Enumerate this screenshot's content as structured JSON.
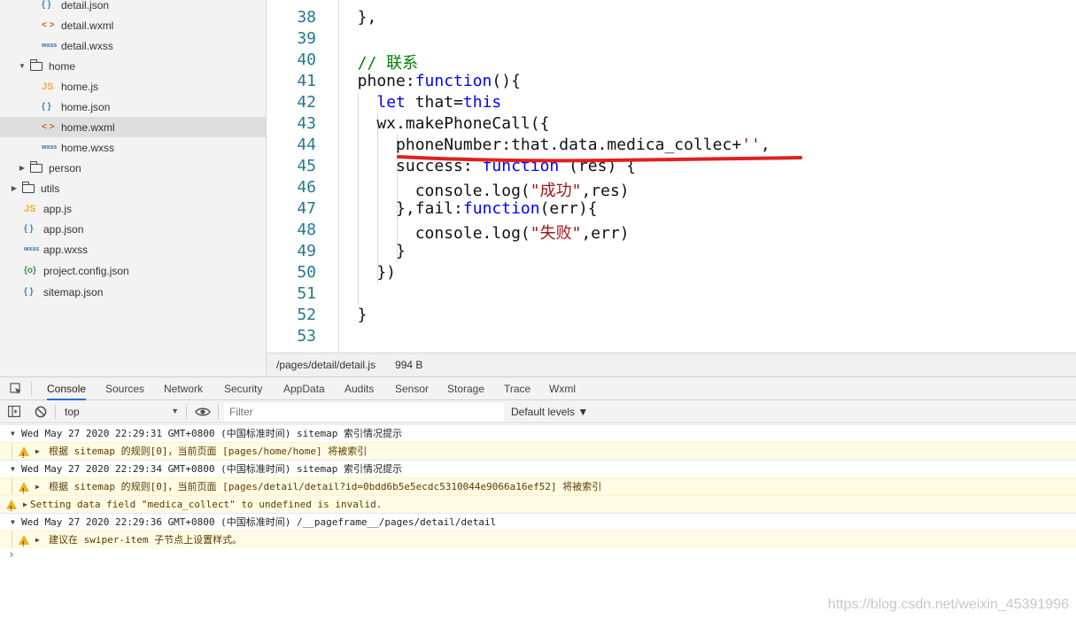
{
  "file_tree": [
    {
      "label": "detail.json",
      "icon": "{ }",
      "type": "json"
    },
    {
      "label": "detail.wxml",
      "icon": "< >",
      "type": "xml"
    },
    {
      "label": "detail.wxss",
      "icon": "wxss",
      "type": "wxss"
    },
    {
      "label": "home",
      "caret": "▼",
      "type": "folder-open"
    },
    {
      "label": "home.js",
      "icon": "JS",
      "type": "js"
    },
    {
      "label": "home.json",
      "icon": "{ }",
      "type": "json"
    },
    {
      "label": "home.wxml",
      "icon": "< >",
      "type": "xml",
      "selected": true
    },
    {
      "label": "home.wxss",
      "icon": "wxss",
      "type": "wxss"
    },
    {
      "label": "person",
      "caret": "▶",
      "type": "folder"
    },
    {
      "label": "utils",
      "caret": "▶",
      "type": "folder"
    },
    {
      "label": "app.js",
      "icon": "JS",
      "type": "js"
    },
    {
      "label": "app.json",
      "icon": "{ }",
      "type": "json"
    },
    {
      "label": "app.wxss",
      "icon": "wxss",
      "type": "wxss"
    },
    {
      "label": "project.config.json",
      "icon": "{o}",
      "type": "cfg"
    },
    {
      "label": "sitemap.json",
      "icon": "{ }",
      "type": "json"
    }
  ],
  "editor": {
    "lines": [
      {
        "n": "38",
        "code": [
          [
            "p",
            "  },"
          ]
        ]
      },
      {
        "n": "39",
        "code": []
      },
      {
        "n": "40",
        "code": [
          [
            "cm",
            "  // 联系"
          ]
        ]
      },
      {
        "n": "41",
        "code": [
          [
            "p",
            "  phone:"
          ],
          [
            "kw",
            "function"
          ],
          [
            "p",
            "(){"
          ]
        ]
      },
      {
        "n": "42",
        "code": [
          [
            "p",
            "    "
          ],
          [
            "kw",
            "let"
          ],
          [
            "p",
            " that="
          ],
          [
            "kw",
            "this"
          ]
        ]
      },
      {
        "n": "43",
        "code": [
          [
            "p",
            "    wx.makePhoneCall({"
          ]
        ]
      },
      {
        "n": "44",
        "code": [
          [
            "p",
            "      phoneNumber:that.data.medica_collec+"
          ],
          [
            "str",
            "''"
          ],
          [
            "p",
            ","
          ]
        ]
      },
      {
        "n": "45",
        "code": [
          [
            "p",
            "      success: "
          ],
          [
            "kw",
            "function"
          ],
          [
            "p",
            " (res) {"
          ]
        ]
      },
      {
        "n": "46",
        "code": [
          [
            "p",
            "        console.log("
          ],
          [
            "str",
            "\"成功\""
          ],
          [
            "p",
            ",res)"
          ]
        ]
      },
      {
        "n": "47",
        "code": [
          [
            "p",
            "      },fail:"
          ],
          [
            "kw",
            "function"
          ],
          [
            "p",
            "(err){"
          ]
        ]
      },
      {
        "n": "48",
        "code": [
          [
            "p",
            "        console.log("
          ],
          [
            "str",
            "\"失败\""
          ],
          [
            "p",
            ",err)"
          ]
        ]
      },
      {
        "n": "49",
        "code": [
          [
            "p",
            "      }"
          ]
        ]
      },
      {
        "n": "50",
        "code": [
          [
            "p",
            "    })"
          ]
        ]
      },
      {
        "n": "51",
        "code": []
      },
      {
        "n": "52",
        "code": [
          [
            "p",
            "  }"
          ]
        ]
      },
      {
        "n": "53",
        "code": []
      }
    ]
  },
  "statusbar": {
    "path": "/pages/detail/detail.js",
    "size": "994 B"
  },
  "devtools": {
    "tabs": [
      "Console",
      "Sources",
      "Network",
      "Security",
      "AppData",
      "Audits",
      "Sensor",
      "Storage",
      "Trace",
      "Wxml"
    ],
    "active_tab": "Console",
    "context": "top",
    "filter_placeholder": "Filter",
    "levels": "Default levels ▼"
  },
  "console": [
    {
      "kind": "group",
      "text": "Wed May 27 2020 22:29:31 GMT+0800 (中国标准时间) sitemap 索引情况提示"
    },
    {
      "kind": "warn-nested",
      "text": "根据 sitemap 的规则[0]，当前页面 [pages/home/home] 将被索引"
    },
    {
      "kind": "group",
      "text": "Wed May 27 2020 22:29:34 GMT+0800 (中国标准时间) sitemap 索引情况提示"
    },
    {
      "kind": "warn-nested",
      "text": "根据 sitemap 的规则[0]，当前页面 [pages/detail/detail?id=0bdd6b5e5ecdc5310044e9066a16ef52] 将被索引"
    },
    {
      "kind": "warn",
      "text": "Setting data field \"medica_collect\" to undefined is invalid."
    },
    {
      "kind": "group",
      "text": "Wed May 27 2020 22:29:36 GMT+0800 (中国标准时间) /__pageframe__/pages/detail/detail"
    },
    {
      "kind": "warn-nested",
      "text": "建议在 swiper-item 子节点上设置样式。"
    }
  ],
  "prompt": "›",
  "watermark": "https://blog.csdn.net/weixin_45391996",
  "colors": {
    "keyword": "#0000ff",
    "string": "#a31515",
    "comment": "#008000",
    "line_number": "#237893",
    "annotation": "#e02020"
  }
}
